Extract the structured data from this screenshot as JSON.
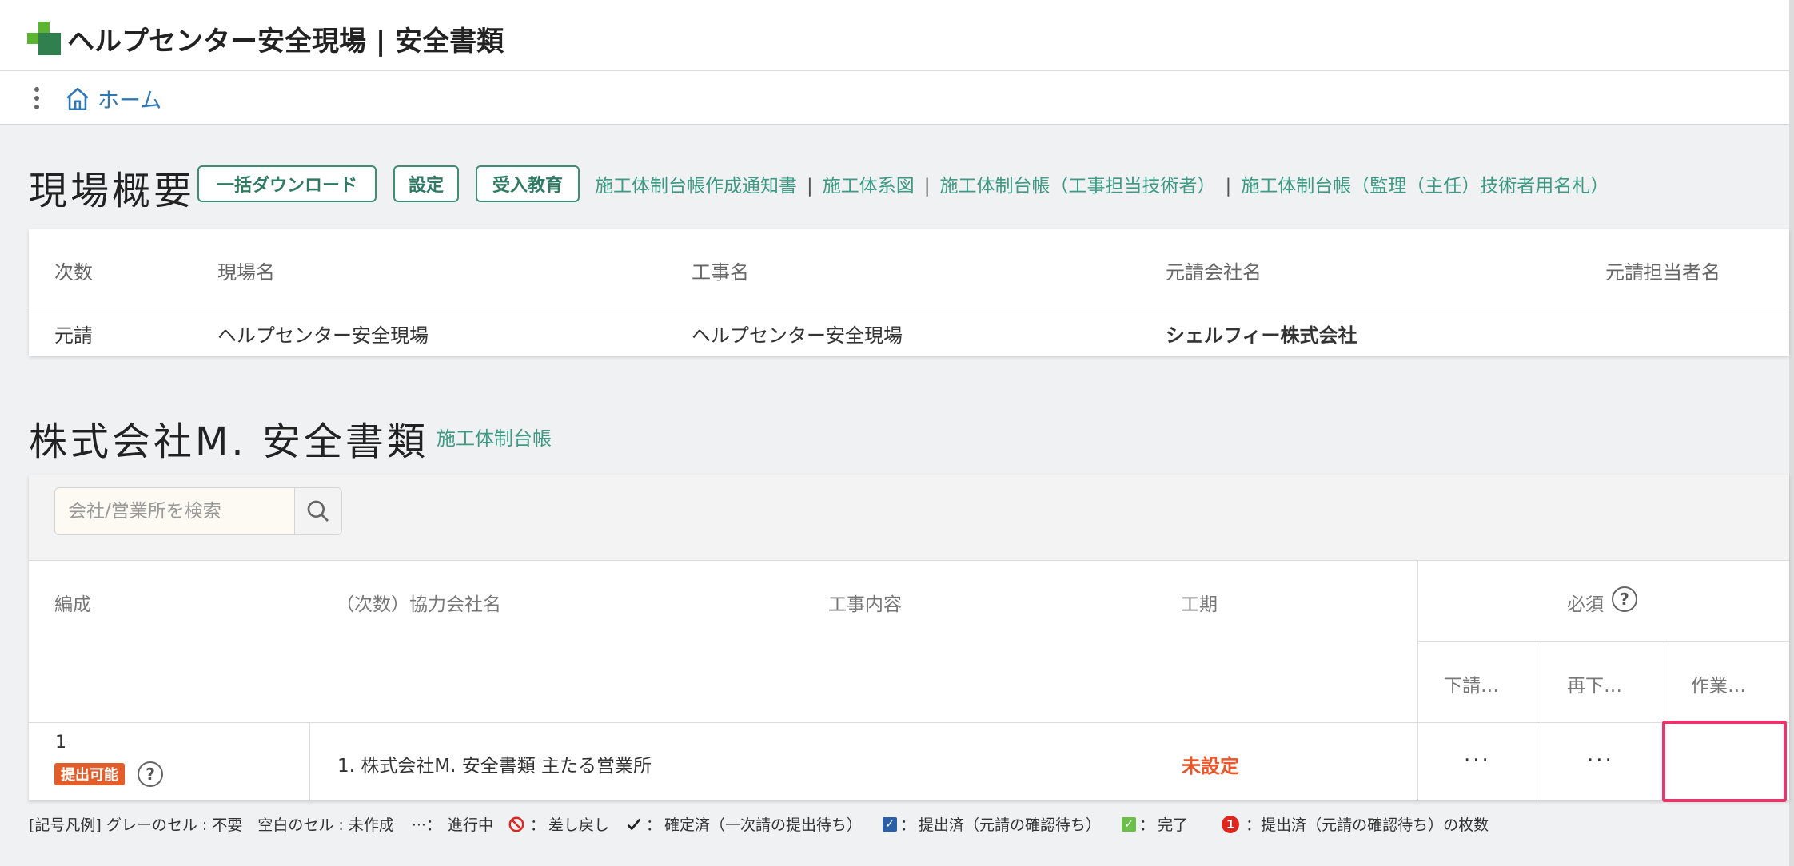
{
  "header": {
    "title": "ヘルプセンター安全現場 | 安全書類"
  },
  "nav": {
    "home": "ホーム"
  },
  "overview": {
    "title": "現場概要",
    "buttons": {
      "download": "一括ダウンロード",
      "settings": "設定",
      "education": "受入教育"
    },
    "links": [
      "施工体制台帳作成通知書",
      "施工体系図",
      "施工体制台帳（工事担当技術者）",
      "施工体制台帳（監理（主任）技術者用名札）"
    ],
    "headers": {
      "order": "次数",
      "site": "現場名",
      "work": "工事名",
      "company": "元請会社名",
      "person": "元請担当者名"
    },
    "row": {
      "order": "元請",
      "site": "ヘルプセンター安全現場",
      "work": "ヘルプセンター安全現場",
      "company": "シェルフィー株式会社",
      "person": ""
    }
  },
  "docs": {
    "title": "株式会社M. 安全書類",
    "ledger_link": "施工体制台帳",
    "search": {
      "placeholder": "会社/営業所を検索",
      "value": ""
    },
    "headers": {
      "composition": "編成",
      "company": "（次数）協力会社名",
      "content": "工事内容",
      "period": "工期",
      "required": "必須",
      "sub1": "下請…",
      "sub2": "再下…",
      "sub3": "作業…"
    },
    "row": {
      "num": "1",
      "badge": "提出可能",
      "company": "1. 株式会社M. 安全書類 主たる営業所",
      "period": "未設定",
      "cell1": "···",
      "cell2": "···",
      "cell3": ""
    }
  },
  "legend": {
    "prefix": "[記号凡例] グレーのセル : 不要　空白のセル : 未作成",
    "progress_mark": "···：",
    "progress": "進行中",
    "returned": "差し戻し",
    "confirmed": "確定済（一次請の提出待ち）",
    "submitted": "提出済（元請の確認待ち）",
    "done": "完了",
    "count_mark": "1",
    "count": "：提出済（元請の確認待ち）の枚数"
  },
  "colors": {
    "accent": "#3d8f74",
    "link": "#3d9a85",
    "alert": "#e8562a",
    "highlight": "#e8356b",
    "badge": "#e35d2a"
  },
  "icons": [
    "logo-cross-icon",
    "kebab-menu-icon",
    "home-icon",
    "search-icon",
    "question-icon",
    "prohibited-icon",
    "check-icon",
    "checkbox-blue-icon",
    "checkbox-green-icon",
    "red-count-icon"
  ]
}
